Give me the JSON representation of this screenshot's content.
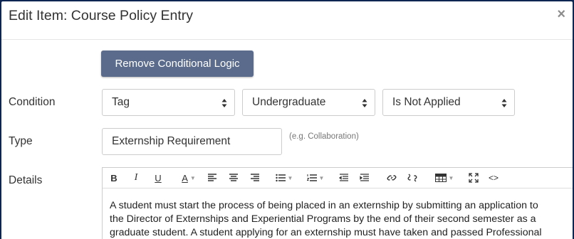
{
  "modal": {
    "title": "Edit Item: Course Policy Entry",
    "close_glyph": "×"
  },
  "remove_conditional_logic_label": "Remove Conditional Logic",
  "condition": {
    "label": "Condition",
    "selects": [
      {
        "value": "Tag"
      },
      {
        "value": "Undergraduate"
      },
      {
        "value": "Is Not Applied"
      }
    ]
  },
  "type": {
    "label": "Type",
    "value": "Externship Requirement",
    "hint": "(e.g. Collaboration)"
  },
  "details": {
    "label": "Details",
    "toolbar": {
      "bold": "B",
      "italic": "I",
      "underline": "U",
      "font_color": "A",
      "code_view": "<>"
    },
    "text_lines": [
      "A student must start the process of being placed in an externship by submitting an application to",
      "the Director of Externships and Experiential Programs by the end of their second semester as a",
      "graduate student. A student applying for an externship must have taken and passed Professional"
    ]
  },
  "colors": {
    "page_background": "#0d2752",
    "primary_button": "#5a6b8c",
    "border": "#cccccc"
  }
}
